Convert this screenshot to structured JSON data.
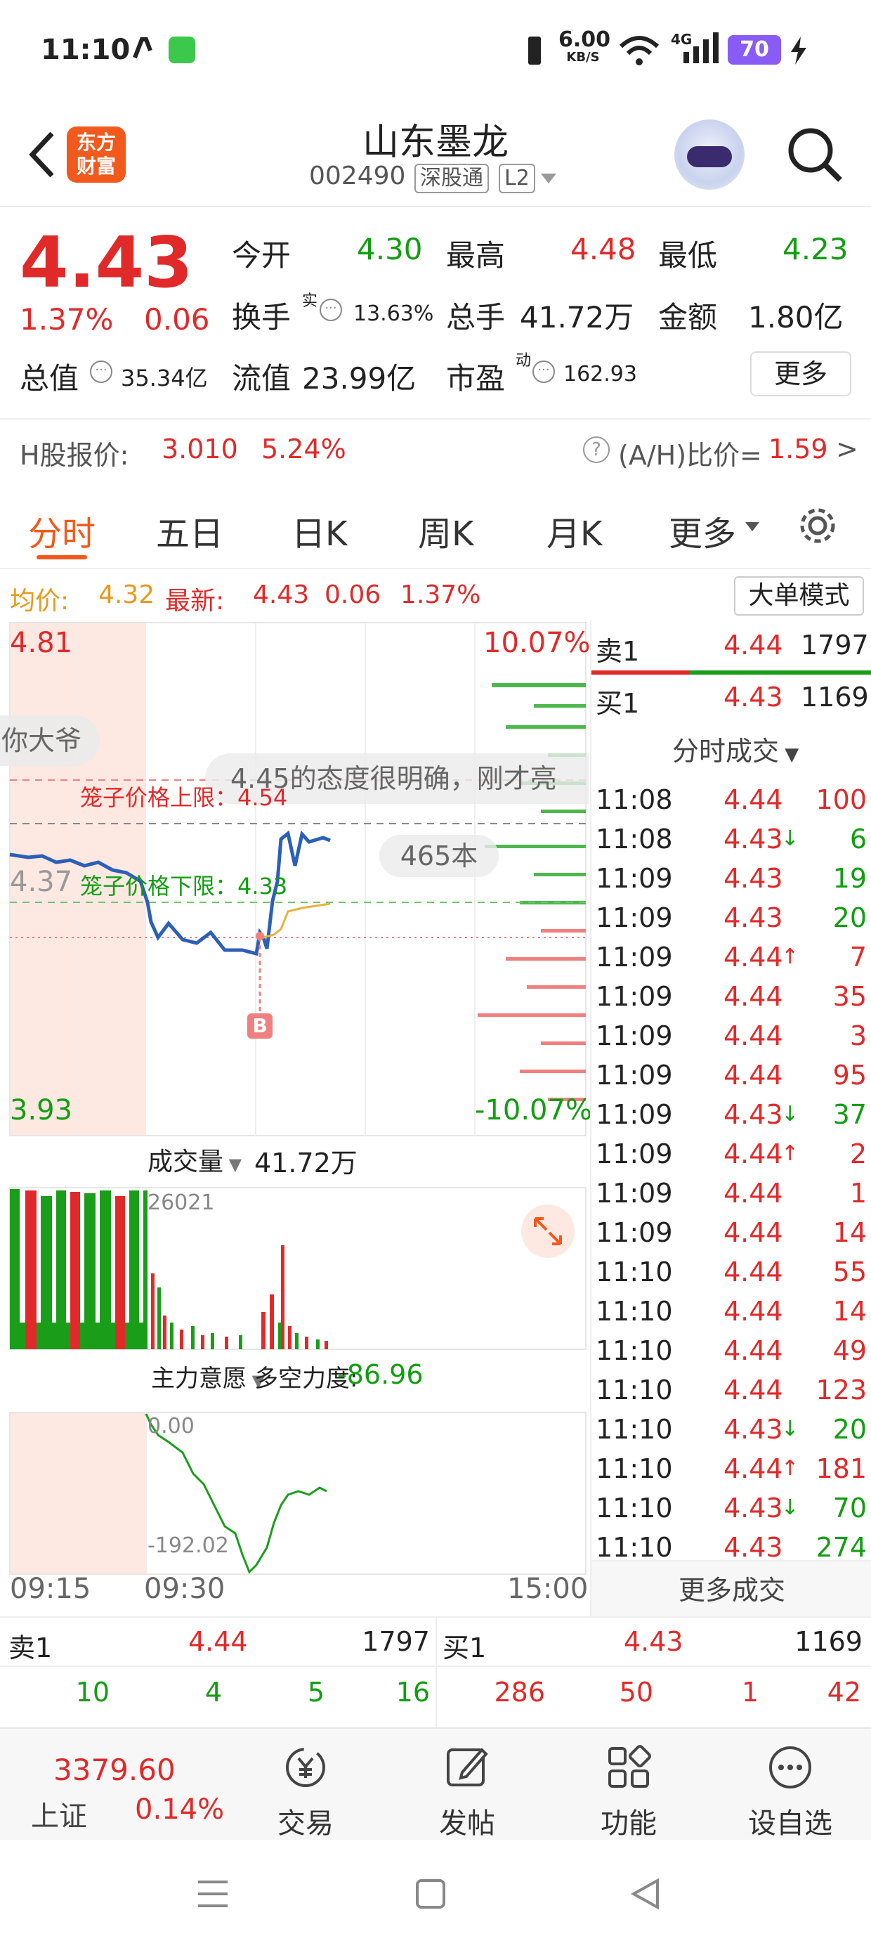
{
  "status": {
    "time": "11:10",
    "net_speed": "6.00",
    "net_unit": "KB/S",
    "signal": "4G",
    "battery": "70"
  },
  "header": {
    "logo_line1": "东方",
    "logo_line2": "财富",
    "name": "山东墨龙",
    "code": "002490",
    "tag1": "深股通",
    "tag2": "L2"
  },
  "quote": {
    "price": "4.43",
    "change_pct": "1.37%",
    "change": "0.06",
    "open_label": "今开",
    "open": "4.30",
    "high_label": "最高",
    "high": "4.48",
    "low_label": "最低",
    "low": "4.23",
    "turnover_label": "换手",
    "turnover_sup": "实",
    "turnover": "13.63%",
    "volume_label": "总手",
    "volume": "41.72万",
    "amount_label": "金额",
    "amount": "1.80亿",
    "mktcap_label": "总值",
    "mktcap": "35.34亿",
    "float_label": "流值",
    "float": "23.99亿",
    "pe_label": "市盈",
    "pe_sup": "动",
    "pe": "162.93",
    "more": "更多",
    "h_label": "H股报价:",
    "h_price": "3.010",
    "h_pct": "5.24%",
    "ah_label": "(A/H)比价=",
    "ah_value": "1.59",
    "ah_arrow": ">"
  },
  "tabs": [
    "分时",
    "五日",
    "日K",
    "周K",
    "月K",
    "更多"
  ],
  "avg": {
    "avg_label": "均价:",
    "avg": "4.32",
    "latest_label": "最新:",
    "latest": "4.43",
    "chg": "0.06",
    "pct": "1.37%",
    "big_mode": "大单模式"
  },
  "chart": {
    "y_max": "4.81",
    "y_min": "3.93",
    "y_mid": "4.37",
    "pct_max": "10.07%",
    "pct_min": "-10.07%",
    "upper_limit": "笼子价格上限：4.54",
    "lower_limit": "笼子价格下限：4.33",
    "marker": "B",
    "barrage1": "4.45的态度很明确，刚才亮",
    "barrage2": "465本",
    "barrage3": "你大爷",
    "vol_label": "成交量",
    "vol_value": "41.72万",
    "vol_max": "26021",
    "ind_label": "主力意愿",
    "ind_sub": "多空力度:",
    "ind_value": "-86.96",
    "ind_top": "0.00",
    "ind_bottom": "-192.02",
    "t_start": "09:15",
    "t_open": "09:30",
    "t_end": "15:00"
  },
  "book_top": {
    "sell_label": "卖1",
    "sell_price": "4.44",
    "sell_vol": "1797",
    "buy_label": "买1",
    "buy_price": "4.43",
    "buy_vol": "1169"
  },
  "ticks_title": "分时成交",
  "ticks": [
    {
      "t": "11:08",
      "p": "4.44",
      "a": "",
      "v": "100"
    },
    {
      "t": "11:08",
      "p": "4.43",
      "a": "↓",
      "v": "6"
    },
    {
      "t": "11:09",
      "p": "4.43",
      "a": "",
      "v": "19"
    },
    {
      "t": "11:09",
      "p": "4.43",
      "a": "",
      "v": "20"
    },
    {
      "t": "11:09",
      "p": "4.44",
      "a": "↑",
      "v": "7"
    },
    {
      "t": "11:09",
      "p": "4.44",
      "a": "",
      "v": "35"
    },
    {
      "t": "11:09",
      "p": "4.44",
      "a": "",
      "v": "3"
    },
    {
      "t": "11:09",
      "p": "4.44",
      "a": "",
      "v": "95"
    },
    {
      "t": "11:09",
      "p": "4.43",
      "a": "↓",
      "v": "37"
    },
    {
      "t": "11:09",
      "p": "4.44",
      "a": "↑",
      "v": "2"
    },
    {
      "t": "11:09",
      "p": "4.44",
      "a": "",
      "v": "1"
    },
    {
      "t": "11:09",
      "p": "4.44",
      "a": "",
      "v": "14"
    },
    {
      "t": "11:10",
      "p": "4.44",
      "a": "",
      "v": "55"
    },
    {
      "t": "11:10",
      "p": "4.44",
      "a": "",
      "v": "14"
    },
    {
      "t": "11:10",
      "p": "4.44",
      "a": "",
      "v": "49"
    },
    {
      "t": "11:10",
      "p": "4.44",
      "a": "",
      "v": "123"
    },
    {
      "t": "11:10",
      "p": "4.43",
      "a": "↓",
      "v": "20"
    },
    {
      "t": "11:10",
      "p": "4.44",
      "a": "↑",
      "v": "181"
    },
    {
      "t": "11:10",
      "p": "4.43",
      "a": "↓",
      "v": "70"
    },
    {
      "t": "11:10",
      "p": "4.43",
      "a": "",
      "v": "274"
    }
  ],
  "ticks_more": "更多成交",
  "orderbook": {
    "sell_label": "卖1",
    "sell_price": "4.44",
    "sell_vol": "1797",
    "buy_label": "买1",
    "buy_price": "4.43",
    "buy_vol": "1169",
    "sell_row": [
      "10",
      "4",
      "5",
      "16"
    ],
    "buy_row": [
      "286",
      "50",
      "1",
      "42"
    ]
  },
  "bottomnav": {
    "index_value": "3379.60",
    "index_name": "上证",
    "index_pct": "0.14%",
    "trade": "交易",
    "post": "发帖",
    "func": "功能",
    "watch": "设自选"
  }
}
